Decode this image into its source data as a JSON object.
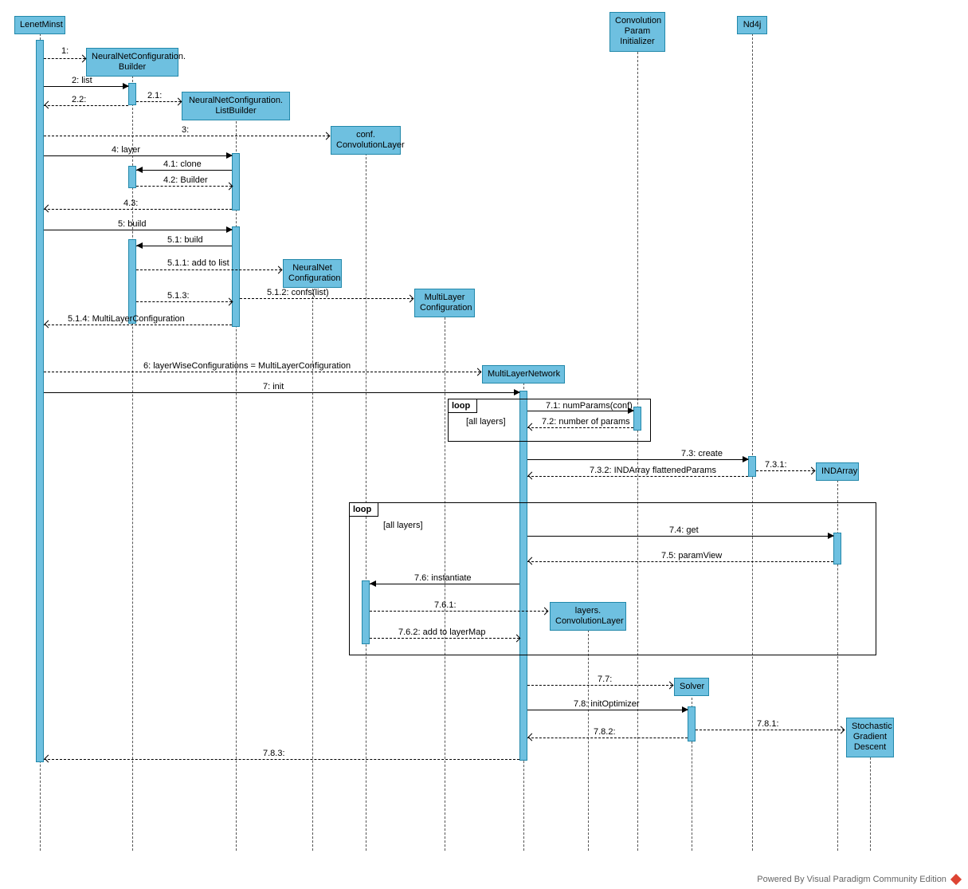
{
  "participants": {
    "lenet": "LenetMinst",
    "builder": "NeuralNetConfiguration.\nBuilder",
    "listBuilder": "NeuralNetConfiguration.\nListBuilder",
    "convLayer": "conf.\nConvolutionLayer",
    "nnconf": "NeuralNet\nConfiguration",
    "mlconf": "MultiLayer\nConfiguration",
    "mlnet": "MultiLayerNetwork",
    "cpi": "Convolution\nParam\nInitializer",
    "nd4j": "Nd4j",
    "indarray": "INDArray",
    "layersConv": "layers.\nConvolutionLayer",
    "solver": "Solver",
    "sgd": "Stochastic\nGradient\nDescent"
  },
  "messages": {
    "m1": "1:",
    "m2": "2: list",
    "m2_1": "2.1:",
    "m2_2": "2.2:",
    "m3": "3:",
    "m4": "4: layer",
    "m4_1": "4.1: clone",
    "m4_2": "4.2: Builder",
    "m4_3": "4.3:",
    "m5": "5: build",
    "m5_1": "5.1: build",
    "m5_1_1": "5.1.1: add to list",
    "m5_1_2": "5.1.2: confs(list)",
    "m5_1_3": "5.1.3:",
    "m5_1_4": "5.1.4: MultiLayerConfiguration",
    "m6": "6: layerWiseConfigurations = MultiLayerConfiguration",
    "m7": "7: init",
    "m7_1": "7.1: numParams(conf)",
    "m7_2": "7.2: number of params",
    "m7_3": "7.3: create",
    "m7_3_1": "7.3.1:",
    "m7_3_2": "7.3.2: INDArray flattenedParams",
    "m7_4": "7.4: get",
    "m7_5": "7.5: paramView",
    "m7_6": "7.6: instantiate",
    "m7_6_1": "7.6.1:",
    "m7_6_2": "7.6.2: add to layerMap",
    "m7_7": "7.7:",
    "m7_8": "7.8: initOptimizer",
    "m7_8_1": "7.8.1:",
    "m7_8_2": "7.8.2:",
    "m7_8_3": "7.8.3:"
  },
  "fragments": {
    "loop1_label": "loop",
    "loop1_guard": "[all layers]",
    "loop2_label": "loop",
    "loop2_guard": "[all layers]"
  },
  "footer": "Powered By Visual Paradigm Community Edition"
}
